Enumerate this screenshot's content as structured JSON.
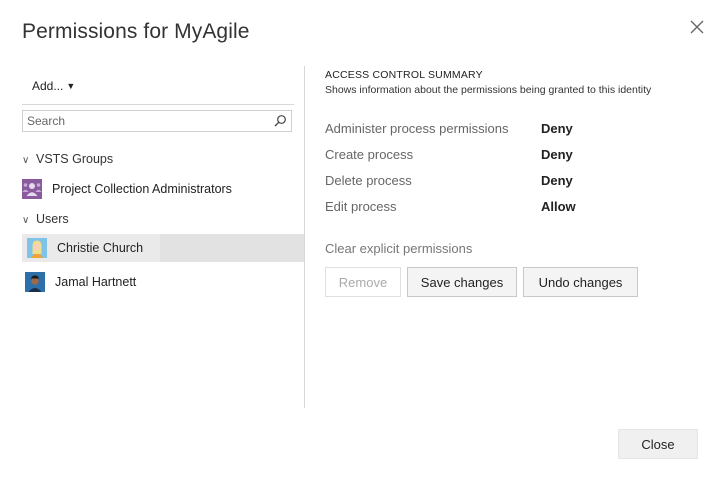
{
  "dialog": {
    "title": "Permissions for MyAgile",
    "close_button": "Close"
  },
  "left": {
    "add_label": "Add...",
    "search_placeholder": "Search",
    "groups": [
      {
        "label": "VSTS Groups",
        "items": [
          "Project Collection Administrators"
        ]
      },
      {
        "label": "Users",
        "items": [
          "Christie Church",
          "Jamal Hartnett"
        ]
      }
    ],
    "selected_item": "Christie Church"
  },
  "right": {
    "summary_title": "ACCESS CONTROL SUMMARY",
    "summary_subtitle": "Shows information about the permissions being granted to this identity",
    "permissions": [
      {
        "name": "Administer process permissions",
        "value": "Deny"
      },
      {
        "name": "Create process",
        "value": "Deny"
      },
      {
        "name": "Delete process",
        "value": "Deny"
      },
      {
        "name": "Edit process",
        "value": "Allow"
      }
    ],
    "clear_link": "Clear explicit permissions",
    "buttons": {
      "remove": "Remove",
      "save": "Save changes",
      "undo": "Undo changes"
    }
  },
  "icons": {
    "close": "close-icon",
    "search": "search-icon",
    "chevron": "chevron-down-icon",
    "caret": "caret-down-icon",
    "group": "group-icon",
    "avatar": "user-avatar"
  }
}
